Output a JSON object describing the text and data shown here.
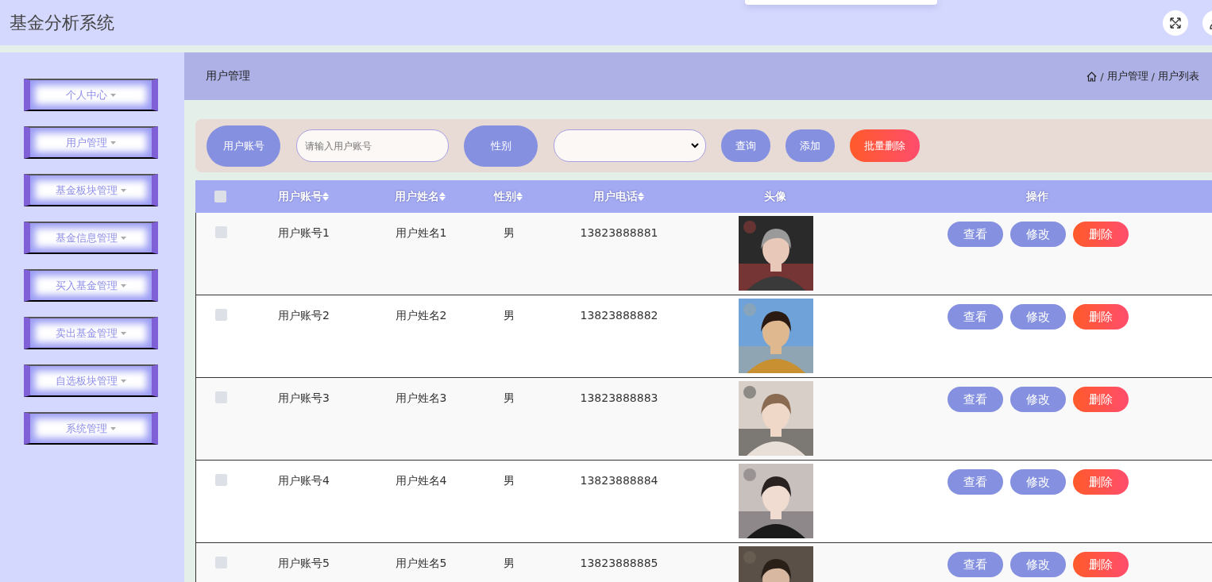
{
  "header": {
    "title": "基金分析系统"
  },
  "sidebar": {
    "items": [
      {
        "label": "个人中心"
      },
      {
        "label": "用户管理"
      },
      {
        "label": "基金板块管理"
      },
      {
        "label": "基金信息管理"
      },
      {
        "label": "买入基金管理"
      },
      {
        "label": "卖出基金管理"
      },
      {
        "label": "自选板块管理"
      },
      {
        "label": "系统管理"
      }
    ]
  },
  "page_header": {
    "title": "用户管理",
    "breadcrumb": {
      "separator": "/",
      "items": [
        "用户管理",
        "用户列表"
      ]
    }
  },
  "search": {
    "fields": [
      {
        "label": "用户账号",
        "kind": "text",
        "placeholder": "请输入用户账号"
      },
      {
        "label": "性别",
        "kind": "select"
      }
    ],
    "buttons": [
      {
        "label": "查询",
        "kind": "primary"
      },
      {
        "label": "添加",
        "kind": "primary"
      },
      {
        "label": "批量删除",
        "kind": "danger"
      }
    ]
  },
  "table": {
    "all_checked": false,
    "columns": [
      {
        "label": "用户账号",
        "sortable": true
      },
      {
        "label": "用户姓名",
        "sortable": true
      },
      {
        "label": "性别",
        "sortable": true
      },
      {
        "label": "用户电话",
        "sortable": true
      },
      {
        "label": "头像",
        "sortable": false
      },
      {
        "label": "操作",
        "sortable": false
      }
    ],
    "rows": [
      {
        "checked": false,
        "account": "用户账号1",
        "name": "用户姓名1",
        "gender": "男",
        "phone": "13823888881",
        "actions": [
          {
            "label": "查看",
            "kind": "primary"
          },
          {
            "label": "修改",
            "kind": "primary"
          },
          {
            "label": "删除",
            "kind": "danger"
          }
        ]
      },
      {
        "checked": false,
        "account": "用户账号2",
        "name": "用户姓名2",
        "gender": "男",
        "phone": "13823888882",
        "actions": [
          {
            "label": "查看",
            "kind": "primary"
          },
          {
            "label": "修改",
            "kind": "primary"
          },
          {
            "label": "删除",
            "kind": "danger"
          }
        ]
      },
      {
        "checked": false,
        "account": "用户账号3",
        "name": "用户姓名3",
        "gender": "男",
        "phone": "13823888883",
        "actions": [
          {
            "label": "查看",
            "kind": "primary"
          },
          {
            "label": "修改",
            "kind": "primary"
          },
          {
            "label": "删除",
            "kind": "danger"
          }
        ]
      },
      {
        "checked": false,
        "account": "用户账号4",
        "name": "用户姓名4",
        "gender": "男",
        "phone": "13823888884",
        "actions": [
          {
            "label": "查看",
            "kind": "primary"
          },
          {
            "label": "修改",
            "kind": "primary"
          },
          {
            "label": "删除",
            "kind": "danger"
          }
        ]
      },
      {
        "checked": false,
        "account": "用户账号5",
        "name": "用户姓名5",
        "gender": "男",
        "phone": "13823888885",
        "actions": [
          {
            "label": "查看",
            "kind": "primary"
          },
          {
            "label": "修改",
            "kind": "primary"
          },
          {
            "label": "删除",
            "kind": "danger"
          }
        ]
      }
    ]
  }
}
